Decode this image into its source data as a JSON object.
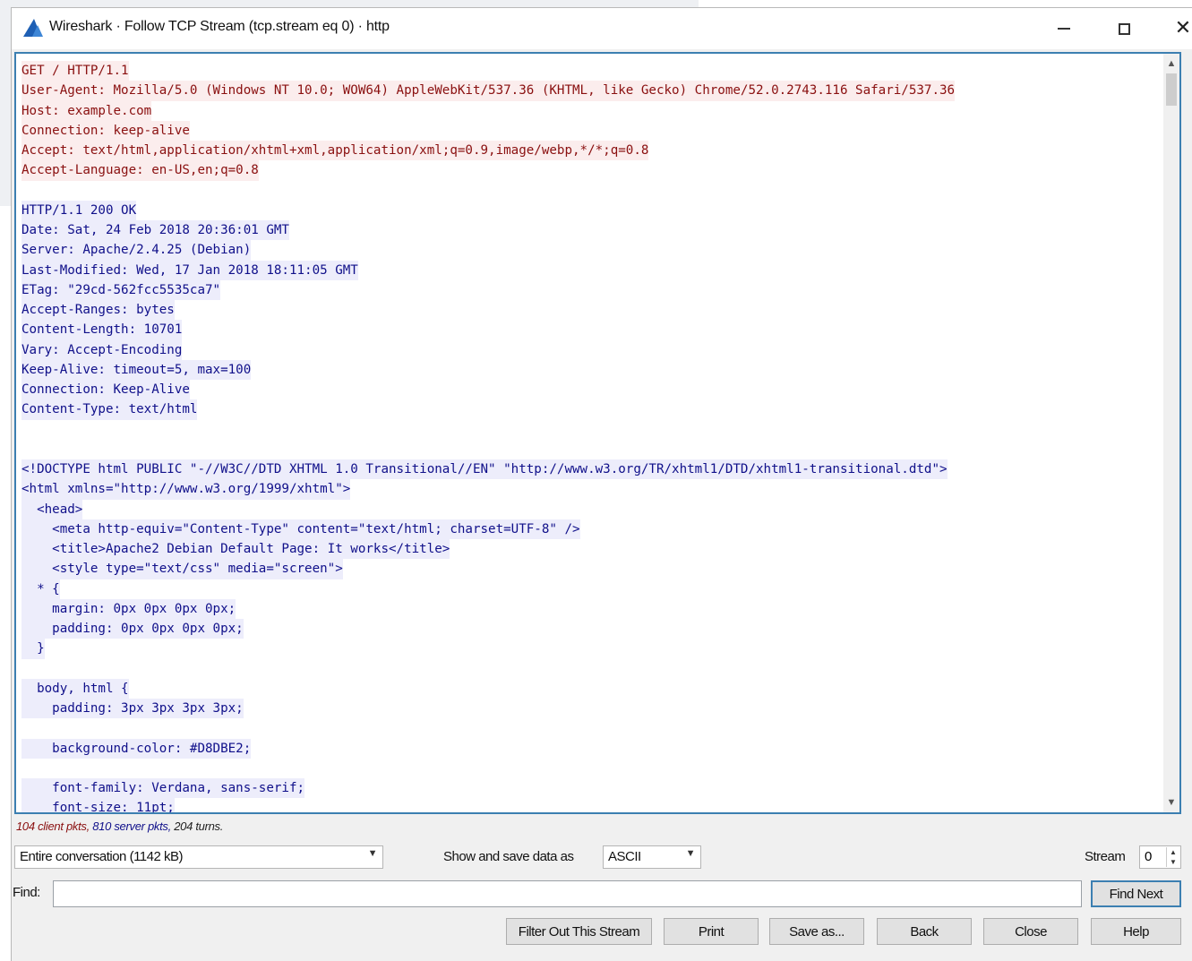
{
  "window": {
    "title": "Wireshark · Follow TCP Stream (tcp.stream eq 0) · http"
  },
  "stream_lines": [
    {
      "text": "GET / HTTP/1.1",
      "dir": "client"
    },
    {
      "text": "User-Agent: Mozilla/5.0 (Windows NT 10.0; WOW64) AppleWebKit/537.36 (KHTML, like Gecko) Chrome/52.0.2743.116 Safari/537.36",
      "dir": "client"
    },
    {
      "text": "Host: example.com",
      "dir": "client"
    },
    {
      "text": "Connection: keep-alive",
      "dir": "client"
    },
    {
      "text": "Accept: text/html,application/xhtml+xml,application/xml;q=0.9,image/webp,*/*;q=0.8",
      "dir": "client"
    },
    {
      "text": "Accept-Language: en-US,en;q=0.8",
      "dir": "client"
    },
    {
      "text": "",
      "dir": "blank"
    },
    {
      "text": "HTTP/1.1 200 OK",
      "dir": "server"
    },
    {
      "text": "Date: Sat, 24 Feb 2018 20:36:01 GMT",
      "dir": "server"
    },
    {
      "text": "Server: Apache/2.4.25 (Debian)",
      "dir": "server"
    },
    {
      "text": "Last-Modified: Wed, 17 Jan 2018 18:11:05 GMT",
      "dir": "server"
    },
    {
      "text": "ETag: \"29cd-562fcc5535ca7\"",
      "dir": "server"
    },
    {
      "text": "Accept-Ranges: bytes",
      "dir": "server"
    },
    {
      "text": "Content-Length: 10701",
      "dir": "server"
    },
    {
      "text": "Vary: Accept-Encoding",
      "dir": "server"
    },
    {
      "text": "Keep-Alive: timeout=5, max=100",
      "dir": "server"
    },
    {
      "text": "Connection: Keep-Alive",
      "dir": "server"
    },
    {
      "text": "Content-Type: text/html",
      "dir": "server"
    },
    {
      "text": "",
      "dir": "blank"
    },
    {
      "text": "",
      "dir": "blank"
    },
    {
      "text": "<!DOCTYPE html PUBLIC \"-//W3C//DTD XHTML 1.0 Transitional//EN\" \"http://www.w3.org/TR/xhtml1/DTD/xhtml1-transitional.dtd\">",
      "dir": "server"
    },
    {
      "text": "<html xmlns=\"http://www.w3.org/1999/xhtml\">",
      "dir": "server"
    },
    {
      "text": "  <head>",
      "dir": "server"
    },
    {
      "text": "    <meta http-equiv=\"Content-Type\" content=\"text/html; charset=UTF-8\" />",
      "dir": "server"
    },
    {
      "text": "    <title>Apache2 Debian Default Page: It works</title>",
      "dir": "server"
    },
    {
      "text": "    <style type=\"text/css\" media=\"screen\">",
      "dir": "server"
    },
    {
      "text": "  * {",
      "dir": "server"
    },
    {
      "text": "    margin: 0px 0px 0px 0px;",
      "dir": "server"
    },
    {
      "text": "    padding: 0px 0px 0px 0px;",
      "dir": "server"
    },
    {
      "text": "  }",
      "dir": "server"
    },
    {
      "text": "",
      "dir": "blank"
    },
    {
      "text": "  body, html {",
      "dir": "server"
    },
    {
      "text": "    padding: 3px 3px 3px 3px;",
      "dir": "server"
    },
    {
      "text": "",
      "dir": "blank"
    },
    {
      "text": "    background-color: #D8DBE2;",
      "dir": "server"
    },
    {
      "text": "",
      "dir": "blank"
    },
    {
      "text": "    font-family: Verdana, sans-serif;",
      "dir": "server"
    },
    {
      "text": "    font-size: 11pt;",
      "dir": "server"
    }
  ],
  "stats": {
    "client": "104 client pkts,",
    "server": "810 server pkts,",
    "turns": "204 turns."
  },
  "controls": {
    "conversation_select": "Entire conversation (1142 kB)",
    "show_label": "Show and save data as",
    "encoding_select": "ASCII",
    "stream_label": "Stream",
    "stream_value": "0",
    "find_label": "Find:",
    "find_value": ""
  },
  "buttons": {
    "find_next": "Find Next",
    "filter_out": "Filter Out This Stream",
    "print": "Print",
    "save_as": "Save as...",
    "back": "Back",
    "close": "Close",
    "help": "Help"
  },
  "colors": {
    "client_text": "#8a1010",
    "client_bg": "#fbeded",
    "server_text": "#10108a",
    "server_bg": "#ededfb",
    "focus_border": "#3c7fb1"
  },
  "icons": {
    "app": "wireshark-fin-icon",
    "minimize": "minimize-icon",
    "maximize": "maximize-icon",
    "close": "close-icon"
  }
}
